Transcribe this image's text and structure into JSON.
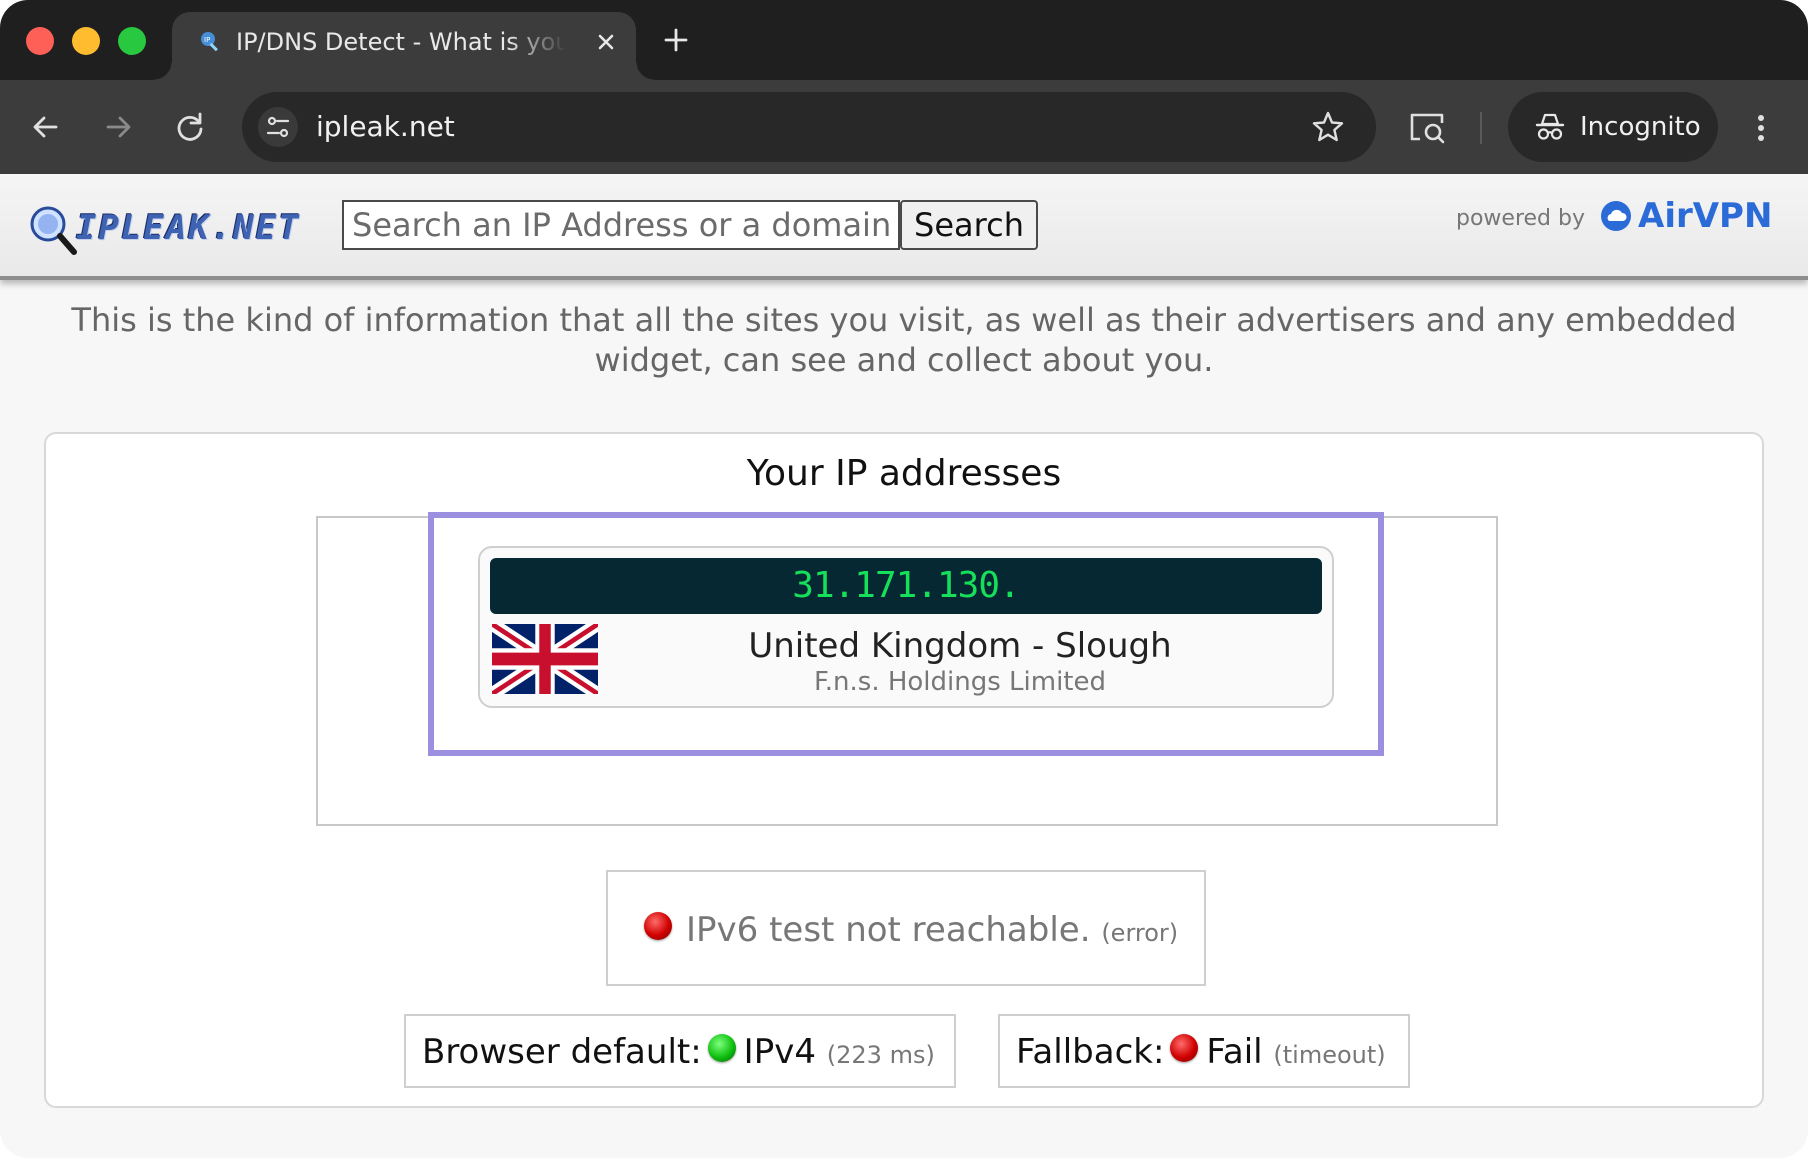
{
  "browser": {
    "tab_title": "IP/DNS Detect - What is your IP, what is your DNS, what informations you send to websites",
    "url": "ipleak.net",
    "incognito_label": "Incognito"
  },
  "header": {
    "logo_text": "IPLEAK.NET",
    "search_placeholder": "Search an IP Address or a domain name",
    "search_button": "Search",
    "powered_by": "powered by",
    "sponsor": "AirVPN"
  },
  "intro": "This is the kind of information that all the sites you visit, as well as their advertisers and any embedded widget, can see and collect about you.",
  "ip_section": {
    "title": "Your IP addresses",
    "ip_address": "31.171.130.",
    "location": "United Kingdom - Slough",
    "isp": "F.n.s. Holdings Limited",
    "flag": "uk-flag"
  },
  "ipv6": {
    "status_color": "#d00000",
    "text": "IPv6 test not reachable.",
    "note": "(error)"
  },
  "browser_default": {
    "label": "Browser default:",
    "status_color": "#10c010",
    "value": "IPv4",
    "note": "(223 ms)"
  },
  "fallback": {
    "label": "Fallback:",
    "status_color": "#d00000",
    "value": "Fail",
    "note": "(timeout)"
  }
}
